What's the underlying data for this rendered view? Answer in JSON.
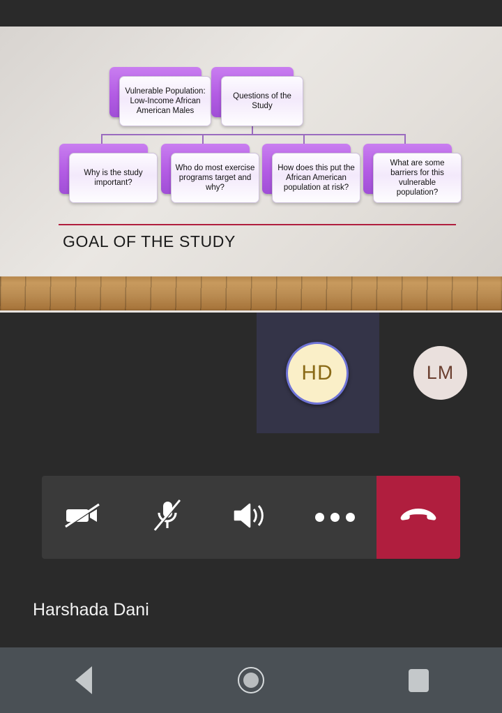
{
  "app": {
    "background_color": "#2a2a2a",
    "accent_red": "#b01e3e"
  },
  "shared_slide": {
    "title": "GOAL OF THE STUDY",
    "rule_color": "#b01e3e",
    "diagram": {
      "level1": [
        {
          "text": "Vulnerable Population: Low-Income African American Males"
        },
        {
          "text": "Questions of the Study"
        }
      ],
      "level2": [
        {
          "text": "Why is the study important?"
        },
        {
          "text": "Who do most exercise programs target and why?"
        },
        {
          "text": "How does this put the African American population at risk?"
        },
        {
          "text": "What are some barriers for this vulnerable population?"
        }
      ]
    }
  },
  "participants": [
    {
      "initials": "HD",
      "speaking": true,
      "bg": "#faefc8",
      "fg": "#8a6a17"
    },
    {
      "initials": "LM",
      "speaking": false,
      "bg": "#eae0dd",
      "fg": "#6b3f30"
    }
  ],
  "toolbar": {
    "camera": {
      "name": "camera-off",
      "state": "off"
    },
    "mic": {
      "name": "mic-off",
      "state": "muted"
    },
    "speaker": {
      "name": "speaker-on",
      "state": "on"
    },
    "more": {
      "name": "more-options"
    },
    "hangup": {
      "name": "end-call",
      "color": "#b01e3e"
    }
  },
  "self": {
    "display_name": "Harshada Dani"
  },
  "navbar": {
    "back": "back",
    "home": "home",
    "recents": "recents"
  }
}
